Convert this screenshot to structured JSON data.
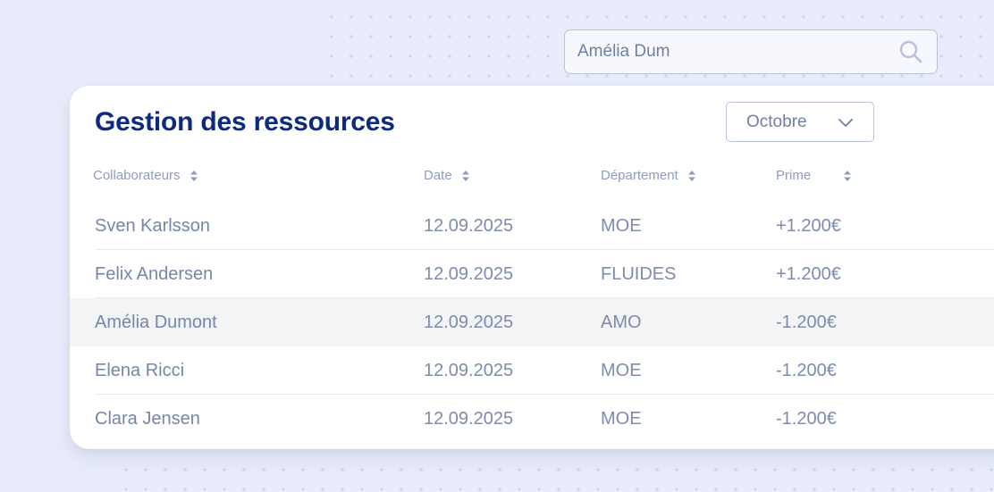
{
  "search": {
    "value": "Amélia Dum",
    "icon": "search-icon"
  },
  "card": {
    "title": "Gestion des ressources",
    "month_select": {
      "selected": "Octobre",
      "icon": "chevron-down-icon"
    }
  },
  "table": {
    "columns": [
      {
        "label": "Collaborateurs",
        "sort_icon": "sort-icon"
      },
      {
        "label": "Date",
        "sort_icon": "sort-icon"
      },
      {
        "label": "Département",
        "sort_icon": "sort-icon"
      },
      {
        "label": "Prime",
        "sort_icon": "sort-icon"
      }
    ],
    "rows": [
      {
        "name": "Sven Karlsson",
        "date": "12.09.2025",
        "department": "MOE",
        "prime": "+1.200€",
        "highlighted": false
      },
      {
        "name": "Felix Andersen",
        "date": "12.09.2025",
        "department": "FLUIDES",
        "prime": "+1.200€",
        "highlighted": false
      },
      {
        "name": "Amélia Dumont",
        "date": "12.09.2025",
        "department": "AMO",
        "prime": "-1.200€",
        "highlighted": true
      },
      {
        "name": "Elena Ricci",
        "date": "12.09.2025",
        "department": "MOE",
        "prime": "-1.200€",
        "highlighted": false
      },
      {
        "name": "Clara Jensen",
        "date": "12.09.2025",
        "department": "MOE",
        "prime": "-1.200€",
        "highlighted": false
      }
    ]
  },
  "colors": {
    "title": "#0d2a80",
    "text": "#7d8cad",
    "header_text": "#8e9cbc",
    "border": "#b8c1dc",
    "highlight_row": "#f3f4f6",
    "background": "#e9edfb"
  }
}
